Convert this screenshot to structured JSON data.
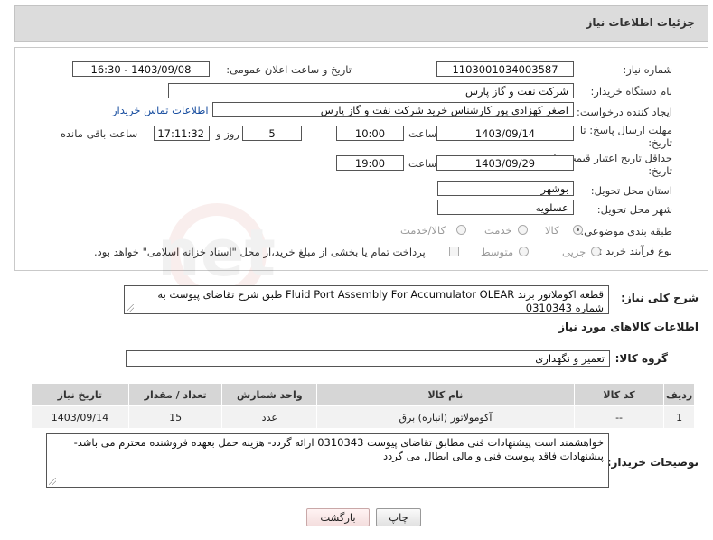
{
  "header": {
    "title": "جزئیات اطلاعات نیاز"
  },
  "form": {
    "need_number_label": "شماره نیاز:",
    "need_number": "1103001034003587",
    "announce_label": "تاریخ و ساعت اعلان عمومی:",
    "announce_value": "1403/09/08 - 16:30",
    "buyer_org_label": "نام دستگاه خریدار:",
    "buyer_org": "شرکت نفت و گاز پارس",
    "creator_label": "ایجاد کننده درخواست:",
    "creator": "اصغر کهزادی پور کارشناس خرید شرکت نفت و گاز پارس",
    "contact_link": "اطلاعات تماس خریدار",
    "reply_deadline_label_1": "مهلت ارسال پاسخ: تا",
    "reply_deadline_label_2": "تاریخ:",
    "reply_date": "1403/09/14",
    "time_label": "ساعت",
    "reply_time": "10:00",
    "days_value": "5",
    "days_label": "روز و",
    "remaining_time": "17:11:32",
    "remaining_label": "ساعت باقی مانده",
    "validity_label_1": "حداقل تاریخ اعتبار قیمت: تا",
    "validity_label_2": "تاریخ:",
    "validity_date": "1403/09/29",
    "validity_time": "19:00",
    "province_label": "استان محل تحویل:",
    "province": "بوشهر",
    "city_label": "شهر محل تحویل:",
    "city": "عسلویه",
    "category_label": "طبقه بندی موضوعی:",
    "category_options": [
      "کالا",
      "خدمت",
      "کالا/خدمت"
    ],
    "process_label": "نوع فرآیند خرید :",
    "process_options": [
      "جزیی",
      "متوسط"
    ],
    "payment_note": "پرداخت تمام یا بخشی از مبلغ خرید،از محل \"اسناد خزانه اسلامی\" خواهد بود."
  },
  "summary": {
    "label": "شرح کلی نیاز:",
    "text": "قطعه اکوملاتور برند Fluid Port Assembly For Accumulator OLEAR طبق شرح تقاضای پیوست به شماره 0310343"
  },
  "goods_info_title": "اطلاعات کالاهای مورد نیاز",
  "goods_group": {
    "label": "گروه کالا:",
    "value": "تعمیر و نگهداری"
  },
  "table": {
    "headers": [
      "ردیف",
      "کد کالا",
      "نام کالا",
      "واحد شمارش",
      "تعداد / مقدار",
      "تاریخ نیاز"
    ],
    "rows": [
      [
        "1",
        "--",
        "آکومولاتور (انباره) برق",
        "عدد",
        "15",
        "1403/09/14"
      ]
    ]
  },
  "buyer_notes": {
    "label": "توضیحات خریدار:",
    "text": "خواهشمند است پیشنهادات فنی مطابق تقاضای پیوست 0310343 ارائه گردد- هزینه حمل بعهده فروشنده محترم می باشد- پیشنهادات فاقد پیوست فنی و مالی ابطال می گردد"
  },
  "buttons": {
    "print": "چاپ",
    "back": "بازگشت"
  },
  "watermark": {
    "text": "AriaTender.net"
  }
}
